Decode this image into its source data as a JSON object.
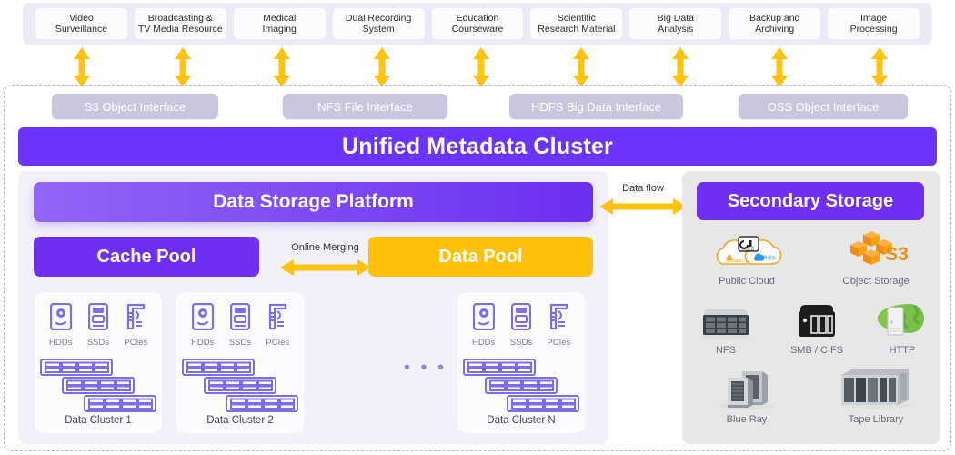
{
  "applications": [
    {
      "label": "Video\nSurveillance",
      "line1": "Video",
      "line2": "Surveillance"
    },
    {
      "label": "Broadcasting & TV Media Resource",
      "line1": "Broadcasting &",
      "line2": "TV Media Resource"
    },
    {
      "label": "Medical Imaging",
      "line1": "Medical",
      "line2": "Imaging"
    },
    {
      "label": "Dual Recording System",
      "line1": "Dual Recording",
      "line2": "System"
    },
    {
      "label": "Education Courseware",
      "line1": "Education",
      "line2": "Courseware"
    },
    {
      "label": "Scientific Research Material",
      "line1": "Scientific",
      "line2": "Research Material"
    },
    {
      "label": "Big Data Analysis",
      "line1": "Big Data",
      "line2": "Analysis"
    },
    {
      "label": "Backup and Archiving",
      "line1": "Backup and",
      "line2": "Archiving"
    },
    {
      "label": "Image Processing",
      "line1": "Image",
      "line2": "Processing"
    }
  ],
  "interfaces": [
    {
      "label": "S3 Object Interface"
    },
    {
      "label": "NFS File Interface"
    },
    {
      "label": "HDFS Big Data Interface"
    },
    {
      "label": "OSS Object Interface"
    }
  ],
  "metadata": {
    "title": "Unified Metadata Cluster"
  },
  "platform": {
    "title": "Data Storage Platform",
    "cache_pool": "Cache Pool",
    "data_pool": "Data Pool",
    "merge_label": "Online Merging"
  },
  "clusters": [
    {
      "name": "Data Cluster 1",
      "media": [
        {
          "label": "HDDs",
          "icon": "hard-disk-icon"
        },
        {
          "label": "SSDs",
          "icon": "ssd-icon"
        },
        {
          "label": "PCIes",
          "icon": "pcie-card-icon"
        }
      ]
    },
    {
      "name": "Data Cluster 2",
      "media": [
        {
          "label": "HDDs",
          "icon": "hard-disk-icon"
        },
        {
          "label": "SSDs",
          "icon": "ssd-icon"
        },
        {
          "label": "PCIes",
          "icon": "pcie-card-icon"
        }
      ]
    },
    {
      "name": "Data Cluster N",
      "media": [
        {
          "label": "HDDs",
          "icon": "hard-disk-icon"
        },
        {
          "label": "SSDs",
          "icon": "ssd-icon"
        },
        {
          "label": "PCIes",
          "icon": "pcie-card-icon"
        }
      ]
    }
  ],
  "cluster_ellipsis": "• • •",
  "dataflow": {
    "label": "Data flow"
  },
  "secondary": {
    "title": "Secondary Storage",
    "items": [
      {
        "label": "Public Cloud",
        "icon": "public-cloud-icon",
        "badges": [
          "amazon",
          "阿里云",
          "腾讯云"
        ]
      },
      {
        "label": "Object Storage",
        "icon": "s3-object-storage-icon",
        "badge": "S3"
      },
      {
        "label": "NFS",
        "icon": "nfs-array-icon"
      },
      {
        "label": "SMB / CIFS",
        "icon": "nas-box-icon"
      },
      {
        "label": "HTTP",
        "icon": "http-globe-icon"
      },
      {
        "label": "Blue Ray",
        "icon": "bluray-cabinet-icon"
      },
      {
        "label": "Tape Library",
        "icon": "tape-library-icon"
      }
    ]
  },
  "colors": {
    "accent_purple": "#6b33fb",
    "platform_gradient_from": "#9166f7",
    "platform_gradient_to": "#6b2ff0",
    "data_pool_amber": "#ffc107",
    "arrow_yellow": "#ffc20e",
    "interface_pill": "#c8c7dd",
    "left_panel_bg": "#f2f1f9",
    "right_panel_bg": "#e7e7e7"
  }
}
